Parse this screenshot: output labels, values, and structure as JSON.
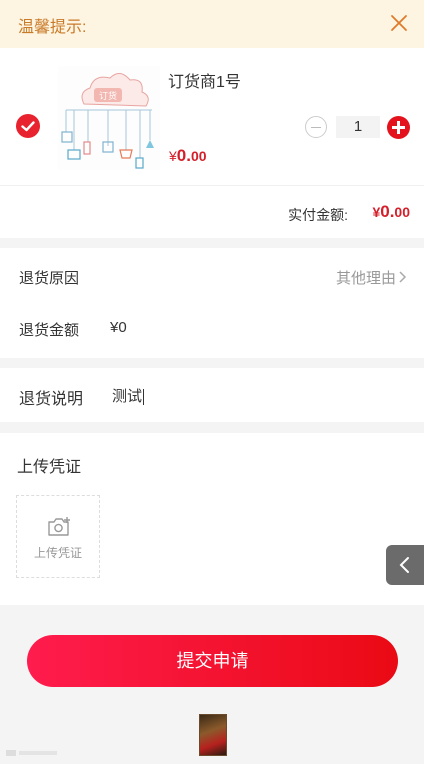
{
  "notice": {
    "text": "温馨提示:"
  },
  "product": {
    "name": "订货商1号",
    "thumb_text": "订货",
    "price_currency": "¥",
    "price_int": "0.",
    "price_dec": "00",
    "quantity": "1"
  },
  "total": {
    "label": "实付金额:",
    "currency": "¥",
    "int": "0.",
    "dec": "00"
  },
  "reason": {
    "label": "退货原因",
    "value": "其他理由"
  },
  "amount": {
    "label": "退货金额",
    "value": "¥0"
  },
  "description": {
    "label": "退货说明",
    "value": "测试"
  },
  "upload": {
    "title": "上传凭证",
    "button_text": "上传凭证"
  },
  "submit": {
    "label": "提交申请"
  },
  "colors": {
    "accent": "#e3121c",
    "notice_text": "#c97a28",
    "notice_bg": "#fdf5e1"
  }
}
